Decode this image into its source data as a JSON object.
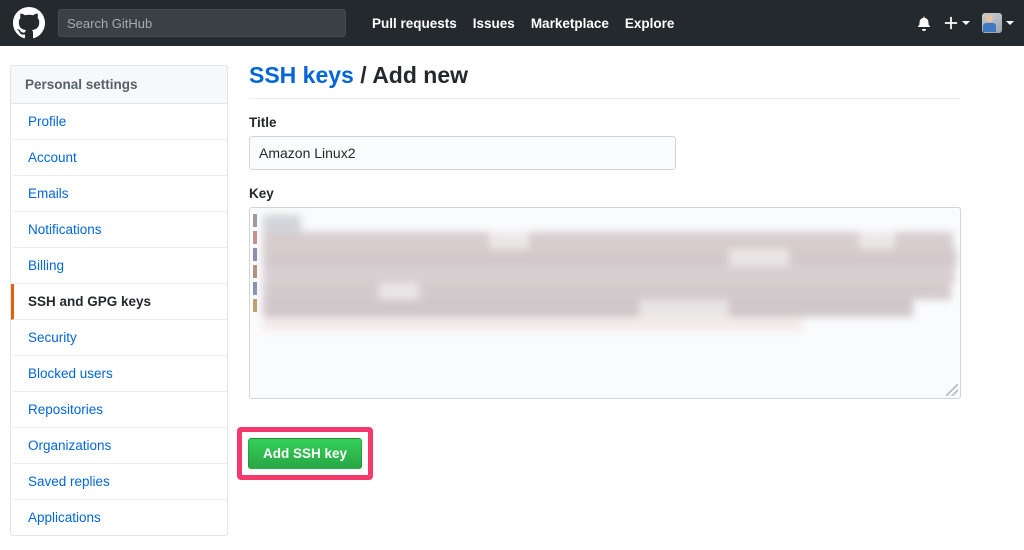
{
  "header": {
    "logo_icon": "github-mark-icon",
    "search": {
      "placeholder": "Search GitHub",
      "value": ""
    },
    "nav": [
      {
        "label": "Pull requests"
      },
      {
        "label": "Issues"
      },
      {
        "label": "Marketplace"
      },
      {
        "label": "Explore"
      }
    ],
    "notifications_icon": "bell-icon",
    "create_new_icon": "plus-icon",
    "avatar_icon": "user-avatar-icon"
  },
  "sidebar": {
    "header": "Personal settings",
    "items": [
      {
        "label": "Profile",
        "active": false
      },
      {
        "label": "Account",
        "active": false
      },
      {
        "label": "Emails",
        "active": false
      },
      {
        "label": "Notifications",
        "active": false
      },
      {
        "label": "Billing",
        "active": false
      },
      {
        "label": "SSH and GPG keys",
        "active": true
      },
      {
        "label": "Security",
        "active": false
      },
      {
        "label": "Blocked users",
        "active": false
      },
      {
        "label": "Repositories",
        "active": false
      },
      {
        "label": "Organizations",
        "active": false
      },
      {
        "label": "Saved replies",
        "active": false
      },
      {
        "label": "Applications",
        "active": false
      }
    ]
  },
  "main": {
    "title_link": "SSH keys",
    "title_separator": " / ",
    "title_current": "Add new",
    "title_field": {
      "label": "Title",
      "value": "Amazon Linux2",
      "placeholder": ""
    },
    "key_field": {
      "label": "Key",
      "value": "",
      "placeholder": "",
      "redacted": true
    },
    "submit_button": {
      "label": "Add SSH key",
      "color": "#28a745",
      "highlighted": true,
      "highlight_color": "#f6396c"
    }
  },
  "colors": {
    "header_bg": "#24292e",
    "link_blue": "#0366d6",
    "active_border": "#e36209",
    "accent_green": "#28a745",
    "highlight_pink": "#f6396c"
  }
}
